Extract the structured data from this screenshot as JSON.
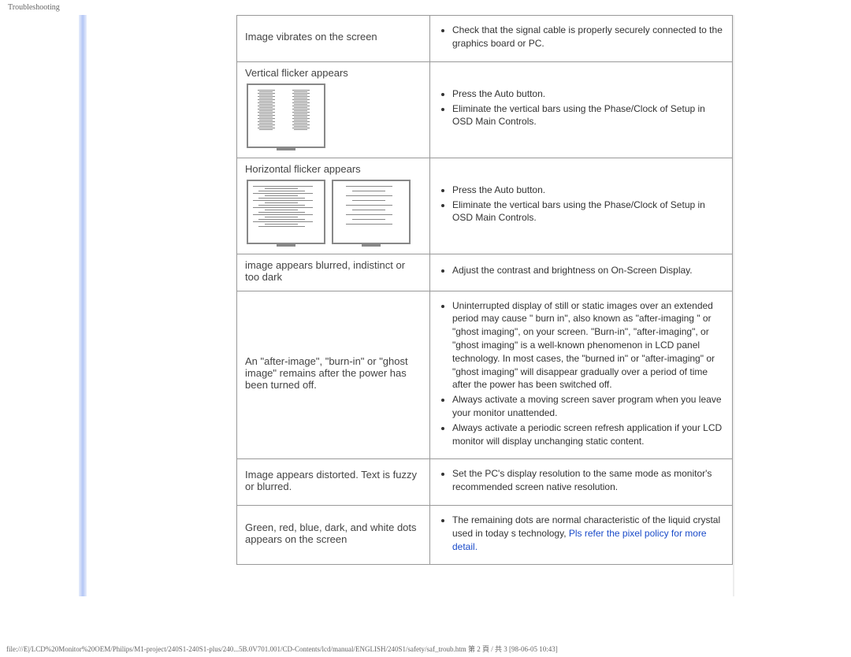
{
  "page_header": "Troubleshooting",
  "rows": [
    {
      "problem": "Image vibrates on the screen",
      "solutions": [
        "Check that the signal cable is properly securely connected to the graphics board or PC."
      ],
      "image": null
    },
    {
      "problem": "Vertical flicker appears",
      "solutions": [
        "Press the Auto button.",
        "Eliminate the vertical bars using the Phase/Clock of Setup in OSD Main Controls."
      ],
      "image": "vertical"
    },
    {
      "problem": "Horizontal flicker appears",
      "solutions": [
        "Press the Auto button.",
        "Eliminate the vertical bars using the Phase/Clock of Setup in OSD Main Controls."
      ],
      "image": "horizontal"
    },
    {
      "problem": "image appears blurred, indistinct or too dark",
      "solutions": [
        "Adjust the contrast and brightness on On-Screen Display."
      ],
      "image": null
    },
    {
      "problem": "An \"after-image\", \"burn-in\" or \"ghost image\" remains after the power has been turned off.",
      "solutions": [
        "Uninterrupted display of still or static images over an extended period may cause \" burn in\", also known as \"after-imaging \" or \"ghost imaging\", on your screen. \"Burn-in\", \"after-imaging\", or \"ghost imaging\" is a well-known phenomenon in LCD panel technology. In most cases, the \"burned in\" or \"after-imaging\" or \"ghost imaging\" will disappear gradually over a period of time after the power has been switched off.",
        "Always activate a moving screen saver program when you leave your monitor unattended.",
        "Always activate a periodic screen refresh application if your LCD monitor will display unchanging static content."
      ],
      "image": null
    },
    {
      "problem": "Image appears distorted. Text   is fuzzy or blurred.",
      "solutions": [
        "Set the PC's display resolution to the same mode as monitor's recommended screen native resolution."
      ],
      "image": null
    },
    {
      "problem": "Green, red, blue, dark, and white dots appears on the screen",
      "solutions_html": true,
      "solution_prefix": "The remaining dots are normal characteristic of the liquid crystal used in today s technology, ",
      "link_text": "Pls refer the pixel policy for more detail.",
      "image": null
    }
  ],
  "footer": "file:///E|/LCD%20Monitor%20OEM/Philips/M1-project/240S1-240S1-plus/240...5B.0V701.001/CD-Contents/lcd/manual/ENGLISH/240S1/safety/saf_troub.htm 第 2 頁 / 共 3  [98-06-05 10:43]"
}
